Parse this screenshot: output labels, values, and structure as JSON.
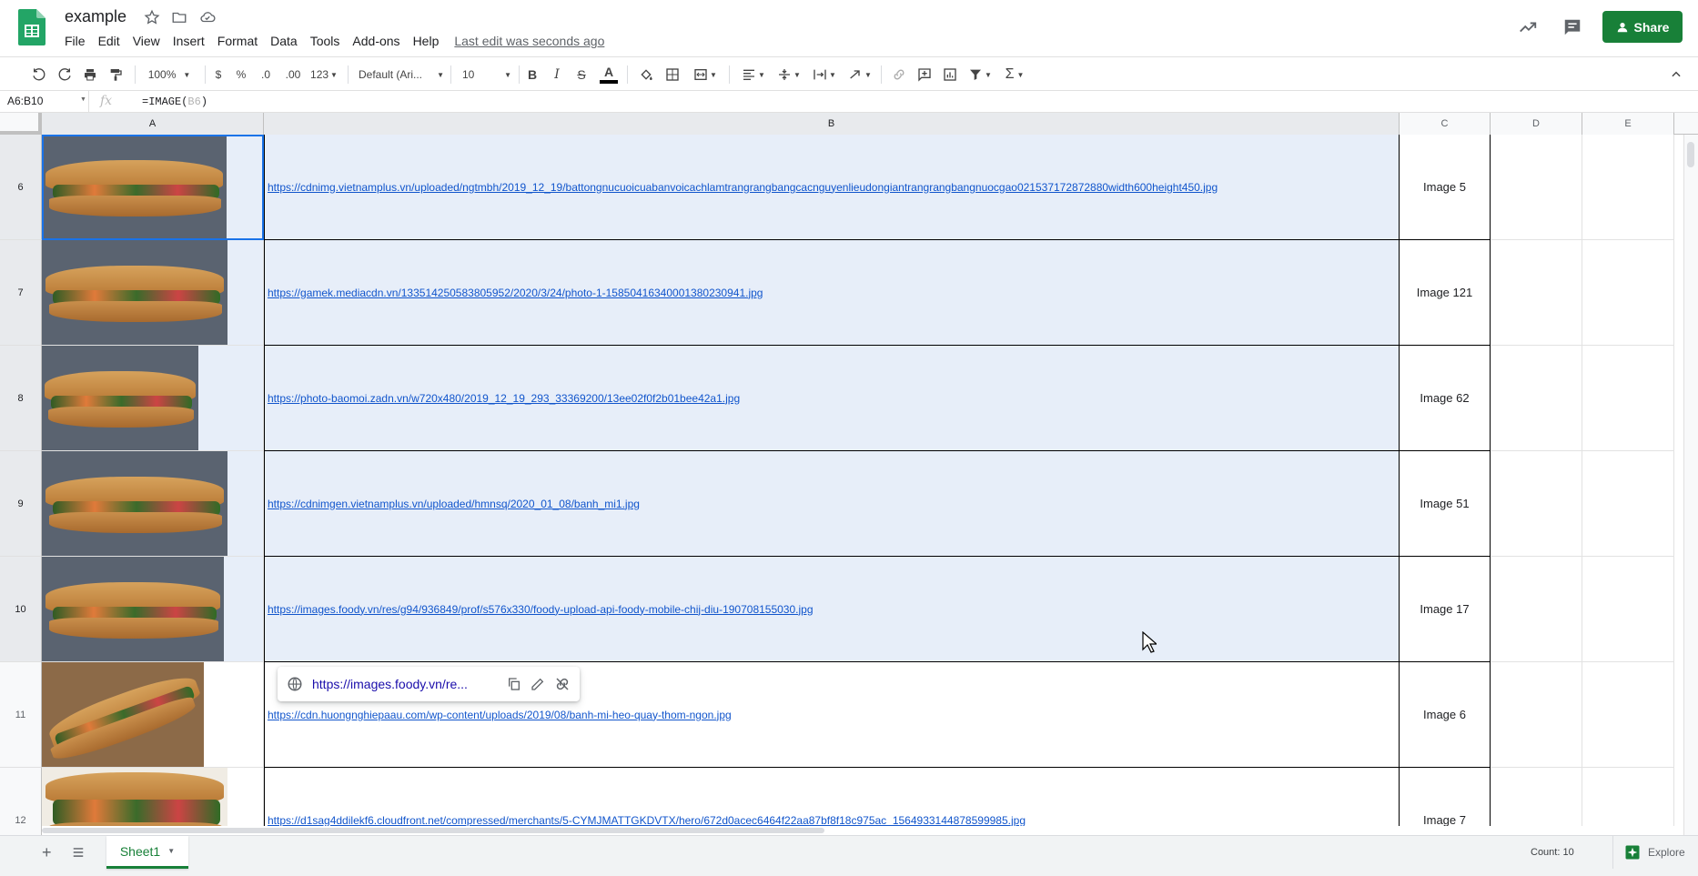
{
  "header": {
    "title": "example",
    "menu": [
      "File",
      "Edit",
      "View",
      "Insert",
      "Format",
      "Data",
      "Tools",
      "Add-ons",
      "Help"
    ],
    "last_edit": "Last edit was seconds ago",
    "share_label": "Share"
  },
  "toolbar": {
    "zoom": "100%",
    "currency": "$",
    "percent": "%",
    "dec_decrease": ".0",
    "dec_increase": ".00",
    "more_formats": "123",
    "font": "Default (Ari...",
    "font_size": "10"
  },
  "formula_bar": {
    "name_box": "A6:B10",
    "formula_prefix": "=IMAGE(",
    "formula_ref": "B6",
    "formula_suffix": ")"
  },
  "columns": [
    "A",
    "B",
    "C",
    "D",
    "E"
  ],
  "rows": [
    {
      "num": "6",
      "url": "https://cdnimg.vietnamplus.vn/uploaded/ngtmbh/2019_12_19/battongnucuoicuabanvoicachlamtrangrangbangcacnguyenlieudongiantrangrangbangnuocgao0215371728728​80width600height450.jpg",
      "label": "Image 5"
    },
    {
      "num": "7",
      "url": "https://gamek.mediacdn.vn/133514250583805952/2020/3/24/photo-1-15850416340001380230941.jpg",
      "label": "Image 121"
    },
    {
      "num": "8",
      "url": "https://photo-baomoi.zadn.vn/w720x480/2019_12_19_293_33369200/13ee02f0f2b01bee42a1.jpg",
      "label": "Image 62"
    },
    {
      "num": "9",
      "url": "https://cdnimgen.vietnamplus.vn/uploaded/hmnsq/2020_01_08/banh_mi1.jpg",
      "label": "Image 51"
    },
    {
      "num": "10",
      "url": "https://images.foody.vn/res/g94/936849/prof/s576x330/foody-upload-api-foody-mobile-chij-diu-190708155030.jpg",
      "label": "Image 17"
    },
    {
      "num": "11",
      "url": "https://cdn.huongnghiepaau.com/wp-content/uploads/2019/08/banh-mi-heo-quay-thom-ngon.jpg",
      "label": "Image 6"
    },
    {
      "num": "12",
      "url": "https://d1sag4ddilekf6.cloudfront.net/compressed/merchants/5-CYMJMATTGKDVTX/hero/672d0acec6464f22aa87bf8f18c975ac_1564933144878599985.jpg",
      "label": "Image 7"
    }
  ],
  "link_popup": {
    "url": "https://images.foody.vn/re..."
  },
  "sheet_tab": "Sheet1",
  "status": {
    "count": "Count: 10",
    "explore": "Explore"
  }
}
